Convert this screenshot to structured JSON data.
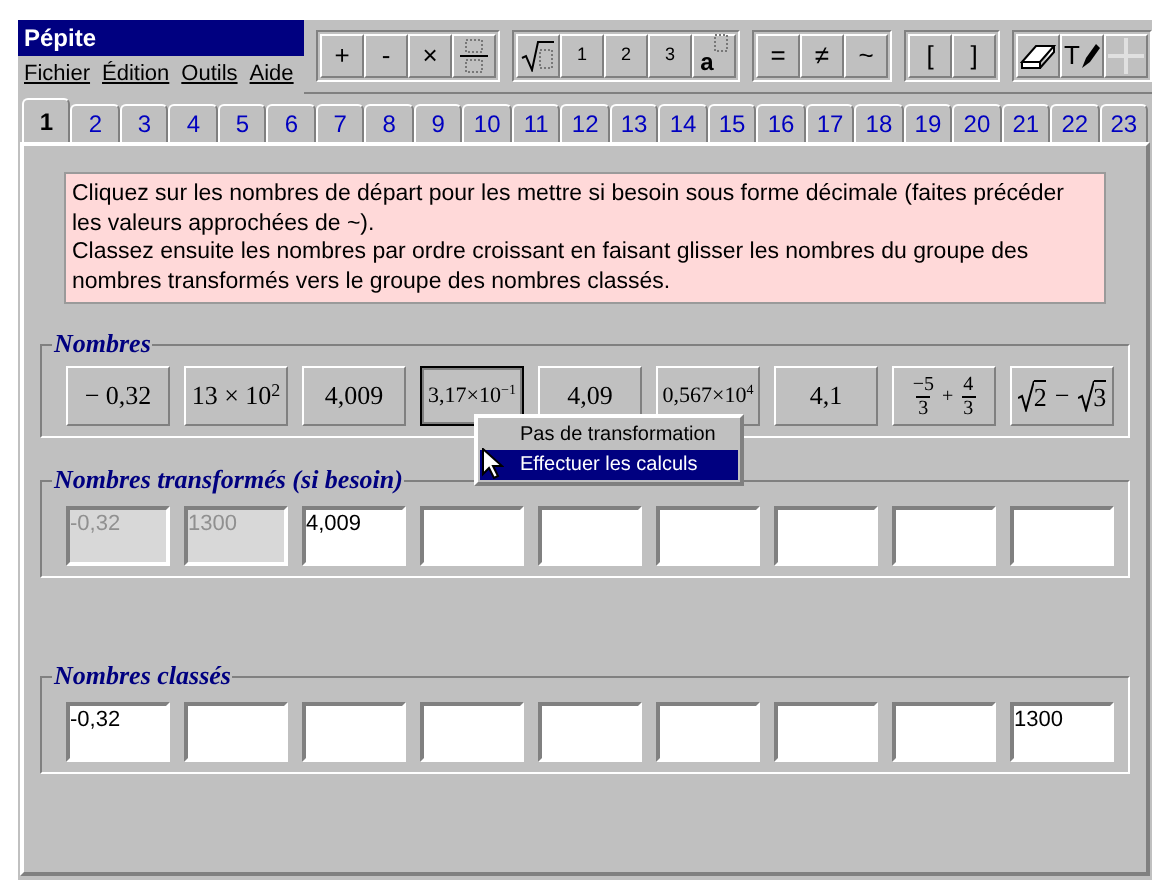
{
  "window": {
    "title": "Pépite"
  },
  "menu": [
    "Fichier",
    "Édition",
    "Outils",
    "Aide"
  ],
  "toolbar": [
    [
      {
        "kind": "text",
        "label": "+"
      },
      {
        "kind": "text",
        "label": "-"
      },
      {
        "kind": "text",
        "label": "×"
      },
      {
        "kind": "fraction"
      }
    ],
    [
      {
        "kind": "sqrt"
      },
      {
        "kind": "digit",
        "label": "1"
      },
      {
        "kind": "digit",
        "label": "2"
      },
      {
        "kind": "digit",
        "label": "3"
      },
      {
        "kind": "power",
        "label": "a"
      }
    ],
    [
      {
        "kind": "text",
        "label": "="
      },
      {
        "kind": "text",
        "label": "≠"
      },
      {
        "kind": "text",
        "label": "~"
      }
    ],
    [
      {
        "kind": "text",
        "label": "["
      },
      {
        "kind": "text",
        "label": "]"
      }
    ],
    [
      {
        "kind": "eraser"
      },
      {
        "kind": "textpen",
        "label": "T"
      },
      {
        "kind": "cross",
        "disabled": true
      }
    ]
  ],
  "tabs": [
    {
      "label": "1",
      "selected": true
    },
    {
      "label": "2",
      "selected": false
    },
    {
      "label": "3",
      "selected": false
    },
    {
      "label": "4",
      "selected": false
    },
    {
      "label": "5",
      "selected": false
    },
    {
      "label": "6",
      "selected": false
    },
    {
      "label": "7",
      "selected": false
    },
    {
      "label": "8",
      "selected": false
    },
    {
      "label": "9",
      "selected": false
    },
    {
      "label": "10",
      "selected": false
    },
    {
      "label": "11",
      "selected": false
    },
    {
      "label": "12",
      "selected": false
    },
    {
      "label": "13",
      "selected": false
    },
    {
      "label": "14",
      "selected": false
    },
    {
      "label": "15",
      "selected": false
    },
    {
      "label": "16",
      "selected": false
    },
    {
      "label": "17",
      "selected": false
    },
    {
      "label": "18",
      "selected": false
    },
    {
      "label": "19",
      "selected": false
    },
    {
      "label": "20",
      "selected": false
    },
    {
      "label": "21",
      "selected": false
    },
    {
      "label": "22",
      "selected": false
    },
    {
      "label": "23",
      "selected": false
    }
  ],
  "instructions": [
    "Cliquez sur les nombres de départ pour les mettre si besoin sous forme décimale (faites précéder les valeurs approchées de ~).",
    "Classez ensuite les nombres par ordre croissant en faisant glisser les nombres du groupe des nombres transformés vers le groupe des nombres classés."
  ],
  "numbers": {
    "title": "Nombres",
    "items": [
      {
        "kind": "text",
        "text": "− 0,32",
        "selected": false
      },
      {
        "kind": "power",
        "base": "13 × 10",
        "exponent": "2",
        "selected": false
      },
      {
        "kind": "text",
        "text": "4,009",
        "selected": false
      },
      {
        "kind": "sci",
        "base": "3,17×10",
        "exponent": "−1",
        "selected": true
      },
      {
        "kind": "text",
        "text": "4,09",
        "selected": false
      },
      {
        "kind": "sci",
        "base": "0,567×10",
        "exponent": "4",
        "selected": false
      },
      {
        "kind": "text",
        "text": "4,1",
        "selected": false
      },
      {
        "kind": "fraction_sum",
        "a_num": "−5",
        "a_den": "3",
        "op": "+",
        "b_num": "4",
        "b_den": "3",
        "selected": false
      },
      {
        "kind": "root_diff",
        "a": "2",
        "op": "−",
        "b": "3",
        "selected": false
      }
    ]
  },
  "context_menu": [
    {
      "label": "Pas de transformation",
      "selected": false
    },
    {
      "label": "Effectuer les calculs",
      "selected": true
    }
  ],
  "transformed": {
    "title": "Nombres transformés (si besoin)",
    "cells": [
      {
        "value": "-0,32",
        "disabled": true
      },
      {
        "value": "1300",
        "disabled": true
      },
      {
        "value": "4,009",
        "disabled": false
      },
      {
        "disabled": false
      },
      {
        "disabled": false
      },
      {
        "disabled": false
      },
      {
        "disabled": false
      },
      {
        "disabled": false
      },
      {
        "disabled": false
      }
    ]
  },
  "sorted": {
    "title": "Nombres classés",
    "cells": [
      {
        "value": "-0,32"
      },
      {},
      {},
      {},
      {},
      {},
      {},
      {},
      {
        "value": "1300"
      }
    ]
  }
}
